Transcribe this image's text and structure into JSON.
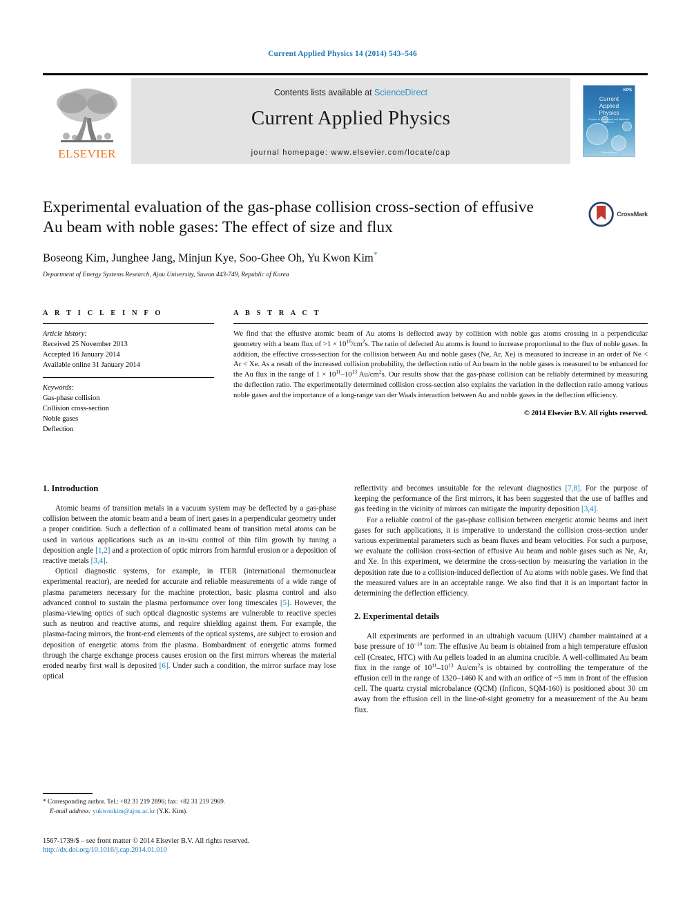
{
  "running_head": "Current Applied Physics 14 (2014) 543–546",
  "masthead": {
    "contents_prefix": "Contents lists available at ",
    "sciencedirect": "ScienceDirect",
    "journal_name": "Current Applied Physics",
    "homepage": "journal homepage: www.elsevier.com/locate/cap",
    "publisher_wordmark": "ELSEVIER",
    "cover": {
      "title_line1": "Current",
      "title_line2": "Applied",
      "title_line3": "Physics",
      "subtitle": "Physics of Condensed and Molecular Systems",
      "society": "KPS",
      "society_sub": "한국물리학회",
      "footer": "ScienceDirect"
    },
    "accent_blue": "#2a8fc4",
    "elsevier_orange": "#E87722"
  },
  "article": {
    "title": "Experimental evaluation of the gas-phase collision cross-section of effusive Au beam with noble gases: The effect of size and flux",
    "authors": "Boseong Kim, Junghee Jang, Minjun Kye, Soo-Ghee Oh, Yu Kwon Kim",
    "corresponding_marker": "*",
    "affiliation": "Department of Energy Systems Research, Ajou University, Suwon 443-749, Republic of Korea",
    "crossmark_label": "CrossMark"
  },
  "article_info": {
    "heading": "A R T I C L E   I N F O",
    "history_label": "Article history:",
    "history": [
      "Received 25 November 2013",
      "Accepted 16 January 2014",
      "Available online 31 January 2014"
    ],
    "keywords_label": "Keywords:",
    "keywords": [
      "Gas-phase collision",
      "Collision cross-section",
      "Noble gases",
      "Deflection"
    ]
  },
  "abstract": {
    "heading": "A B S T R A C T",
    "paragraphs": [
      "We find that the effusive atomic beam of Au atoms is deflected away by collision with noble gas atoms crossing in a perpendicular geometry with a beam flux of >1 × 10^16/cm^2s. The ratio of defected Au atoms is found to increase proportional to the flux of noble gases. In addition, the effective cross-section for the collision between Au and noble gases (Ne, Ar, Xe) is measured to increase in an order of Ne < Ar < Xe. As a result of the increased collision probability, the deflection ratio of Au beam in the noble gases is measured to be enhanced for the Au flux in the range of 1 × 10^11–10^13 Au/cm^2s. Our results show that the gas-phase collision can be reliably determined by measuring the deflection ratio. The experimentally determined collision cross-section also explains the variation in the deflection ratio among various noble gases and the importance of a long-range van der Waals interaction between Au and noble gases in the deflection efficiency."
    ],
    "copyright": "© 2014 Elsevier B.V. All rights reserved."
  },
  "sections": {
    "introduction": {
      "heading": "1.  Introduction",
      "p1_a": "Atomic beams of transition metals in a vacuum system may be deflected by a gas-phase collision between the atomic beam and a beam of inert gases in a perpendicular geometry under a proper condition. Such a deflection of a collimated beam of transition metal atoms can be used in various applications such as an in-situ control of thin film growth by tuning a deposition angle ",
      "p1_cite1": "[1,2]",
      "p1_b": " and a protection of optic mirrors from harmful erosion or a deposition of reactive metals ",
      "p1_cite2": "[3,4]",
      "p1_c": ".",
      "p2_a": "Optical diagnostic systems, for example, in ITER (international thermonuclear experimental reactor), are needed for accurate and reliable measurements of a wide range of plasma parameters necessary for the machine protection, basic plasma control and also advanced control to sustain the plasma performance over long timescales ",
      "p2_cite1": "[5]",
      "p2_b": ". However, the plasma-viewing optics of such optical diagnostic systems are vulnerable to reactive species such as neutron and reactive atoms, and require shielding against them. For example, the plasma-facing mirrors, the front-end elements of the optical systems, are subject to erosion and deposition of energetic atoms from the plasma. Bombardment of energetic atoms formed through the charge exchange process causes erosion on the first mirrors whereas the material eroded nearby first wall is deposited ",
      "p2_cite2": "[6]",
      "p2_c": ". Under such a condition, the mirror surface may lose optical ",
      "p2_cont_a": "reflectivity and becomes unsuitable for the relevant diagnostics ",
      "p2_cont_cite": "[7,8]",
      "p2_cont_b": ". For the purpose of keeping the performance of the first mirrors, it has been suggested that the use of baffles and gas feeding in the vicinity of mirrors can mitigate the impurity deposition ",
      "p2_cont_cite2": "[3,4]",
      "p2_cont_c": ".",
      "p3": "For a reliable control of the gas-phase collision between energetic atomic beams and inert gases for such applications, it is imperative to understand the collision cross-section under various experimental parameters such as beam fluxes and beam velocities. For such a purpose, we evaluate the collision cross-section of effusive Au beam and noble gases such as Ne, Ar, and Xe. In this experiment, we determine the cross-section by measuring the variation in the deposition rate due to a collision-induced deflection of Au atoms with noble gases. We find that the measured values are in an acceptable range. We also find that it is an important factor in determining the deflection efficiency."
    },
    "experimental": {
      "heading": "2.  Experimental details",
      "p1_a": "All experiments are performed in an ultrahigh vacuum (UHV) chamber maintained at a base pressure of 10",
      "p1_sup1": "−10",
      "p1_b": " torr. The effusive Au beam is obtained from a high temperature effusion cell (Createc, HTC) with Au pellets loaded in an alumina crucible. A well-collimated Au beam flux in the range of 10",
      "p1_sup2": "11",
      "p1_c": "–10",
      "p1_sup3": "13",
      "p1_d": " Au/cm",
      "p1_sup4": "2",
      "p1_e": "s is obtained by controlling the temperature of the effusion cell in the range of 1320–1460 K and with an orifice of ~5 mm in front of the effusion cell. The quartz crystal microbalance (QCM) (Inficon, SQM-160) is positioned about 30 cm away from the effusion cell in the line-of-sight geometry for a measurement of the Au beam flux."
    }
  },
  "footnote": {
    "marker": "*",
    "corresponding": " Corresponding author. Tel.: +82 31 219 2896; fax: +82 31 219 2969.",
    "email_label": "E-mail address:",
    "email": "yukwonkim@ajou.ac.kr",
    "email_suffix": " (Y.K. Kim)."
  },
  "bottom": {
    "issn_line": "1567-1739/$ – see front matter © 2014 Elsevier B.V. All rights reserved.",
    "doi": "http://dx.doi.org/10.1016/j.cap.2014.01.010"
  }
}
